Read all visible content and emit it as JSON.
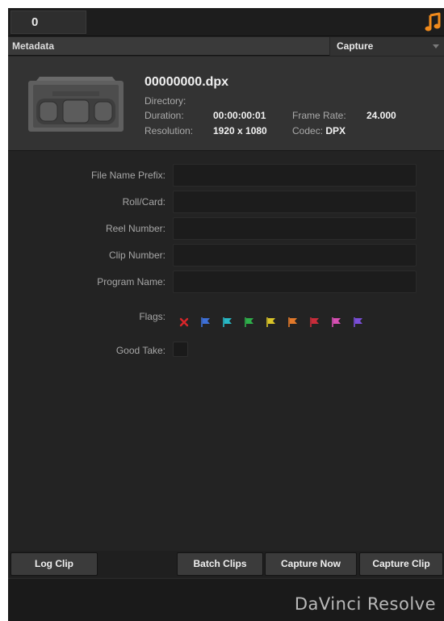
{
  "topbar": {
    "counter": "0",
    "audio_icon": "music-note-icon",
    "accent": "#f08a1c"
  },
  "metadata_header": {
    "title": "Metadata",
    "preset": "Capture"
  },
  "clip": {
    "thumbnail_icon": "video-tape-icon",
    "name": "00000000.dpx",
    "directory_label": "Directory:",
    "directory_value": "",
    "duration_label": "Duration:",
    "duration_value": "00:00:00:01",
    "frame_rate_label": "Frame Rate:",
    "frame_rate_value": "24.000",
    "resolution_label": "Resolution:",
    "resolution_value": "1920 x 1080",
    "codec_label": "Codec:",
    "codec_value": "DPX"
  },
  "form": {
    "file_name_prefix": {
      "label": "File Name Prefix:",
      "value": ""
    },
    "roll_card": {
      "label": "Roll/Card:",
      "value": ""
    },
    "reel_number": {
      "label": "Reel Number:",
      "value": ""
    },
    "clip_number": {
      "label": "Clip Number:",
      "value": ""
    },
    "program_name": {
      "label": "Program Name:",
      "value": ""
    },
    "flags_label": "Flags:",
    "flags": [
      {
        "name": "clear-flags-icon",
        "color": "#d8262a"
      },
      {
        "name": "flag-blue-icon",
        "color": "#3d6fd6"
      },
      {
        "name": "flag-cyan-icon",
        "color": "#28b7c4"
      },
      {
        "name": "flag-green-icon",
        "color": "#2eae4a"
      },
      {
        "name": "flag-yellow-icon",
        "color": "#d9c428"
      },
      {
        "name": "flag-orange-icon",
        "color": "#e2792a"
      },
      {
        "name": "flag-red-icon",
        "color": "#c92c3a"
      },
      {
        "name": "flag-pink-icon",
        "color": "#d74fb3"
      },
      {
        "name": "flag-purple-icon",
        "color": "#7a4ed8"
      }
    ],
    "good_take_label": "Good Take:"
  },
  "buttons": {
    "log_clip": "Log Clip",
    "batch_clips": "Batch Clips",
    "capture_now": "Capture Now",
    "capture_clip": "Capture Clip"
  },
  "footer": {
    "brand": "DaVinci Resolve"
  }
}
